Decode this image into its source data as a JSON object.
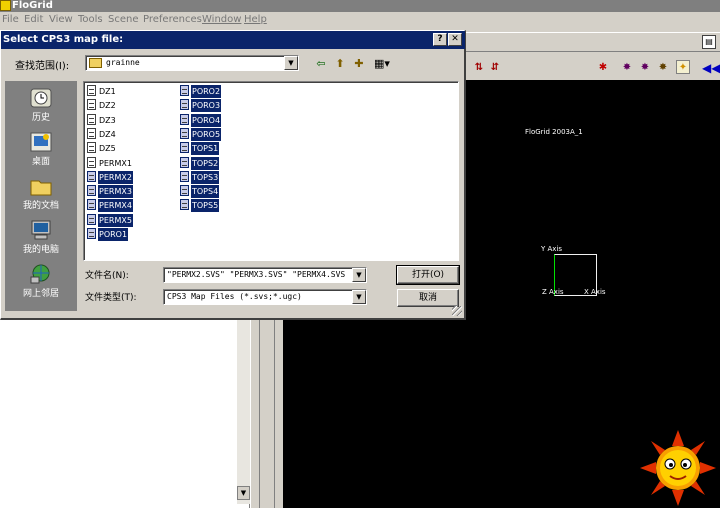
{
  "app": {
    "title": "FloGrid",
    "logo_text": "Flo Grid"
  },
  "menu": [
    {
      "label": "File"
    },
    {
      "label": "Edit"
    },
    {
      "label": "View"
    },
    {
      "label": "Tools"
    },
    {
      "label": "Scene"
    },
    {
      "label": "Preferences"
    },
    {
      "label": "Window"
    },
    {
      "label": "Help"
    }
  ],
  "dialog": {
    "title": "Select CPS3 map file:",
    "help_btn": "?",
    "close_btn": "✕",
    "look_in_label": "查找范围(I):",
    "look_in_value": "grainne",
    "places": [
      {
        "label": "历史",
        "icon": "history-icon"
      },
      {
        "label": "桌面",
        "icon": "desktop-icon"
      },
      {
        "label": "我的文档",
        "icon": "my-documents-icon"
      },
      {
        "label": "我的电脑",
        "icon": "my-computer-icon"
      },
      {
        "label": "网上邻居",
        "icon": "network-places-icon"
      }
    ],
    "files_col1": [
      {
        "name": "DZ1",
        "selected": false
      },
      {
        "name": "DZ2",
        "selected": false
      },
      {
        "name": "DZ3",
        "selected": false
      },
      {
        "name": "DZ4",
        "selected": false
      },
      {
        "name": "DZ5",
        "selected": false
      },
      {
        "name": "PERMX1",
        "selected": false
      },
      {
        "name": "PERMX2",
        "selected": true
      },
      {
        "name": "PERMX3",
        "selected": true
      },
      {
        "name": "PERMX4",
        "selected": true
      },
      {
        "name": "PERMX5",
        "selected": true
      },
      {
        "name": "PORO1",
        "selected": true
      }
    ],
    "files_col2": [
      {
        "name": "PORO2",
        "selected": true
      },
      {
        "name": "PORO3",
        "selected": true
      },
      {
        "name": "PORO4",
        "selected": true
      },
      {
        "name": "PORO5",
        "selected": true
      },
      {
        "name": "TOPS1",
        "selected": true
      },
      {
        "name": "TOPS2",
        "selected": true
      },
      {
        "name": "TOPS3",
        "selected": true
      },
      {
        "name": "TOPS4",
        "selected": true
      },
      {
        "name": "TOPS5",
        "selected": true
      }
    ],
    "filename_label": "文件名(N):",
    "filename_value": "\"PERMX2.SVS\" \"PERMX3.SVS\" \"PERMX4.SVS",
    "filetype_label": "文件类型(T):",
    "filetype_value": "CPS3 Map Files (*.svs;*.ugc)",
    "open_button": "打开(O)",
    "cancel_button": "取消"
  },
  "viewport": {
    "label": "FloGrid 2003A_1",
    "y_axis": "Y Axis",
    "z_axis": "Z Axis",
    "x_axis": "X Axis"
  }
}
